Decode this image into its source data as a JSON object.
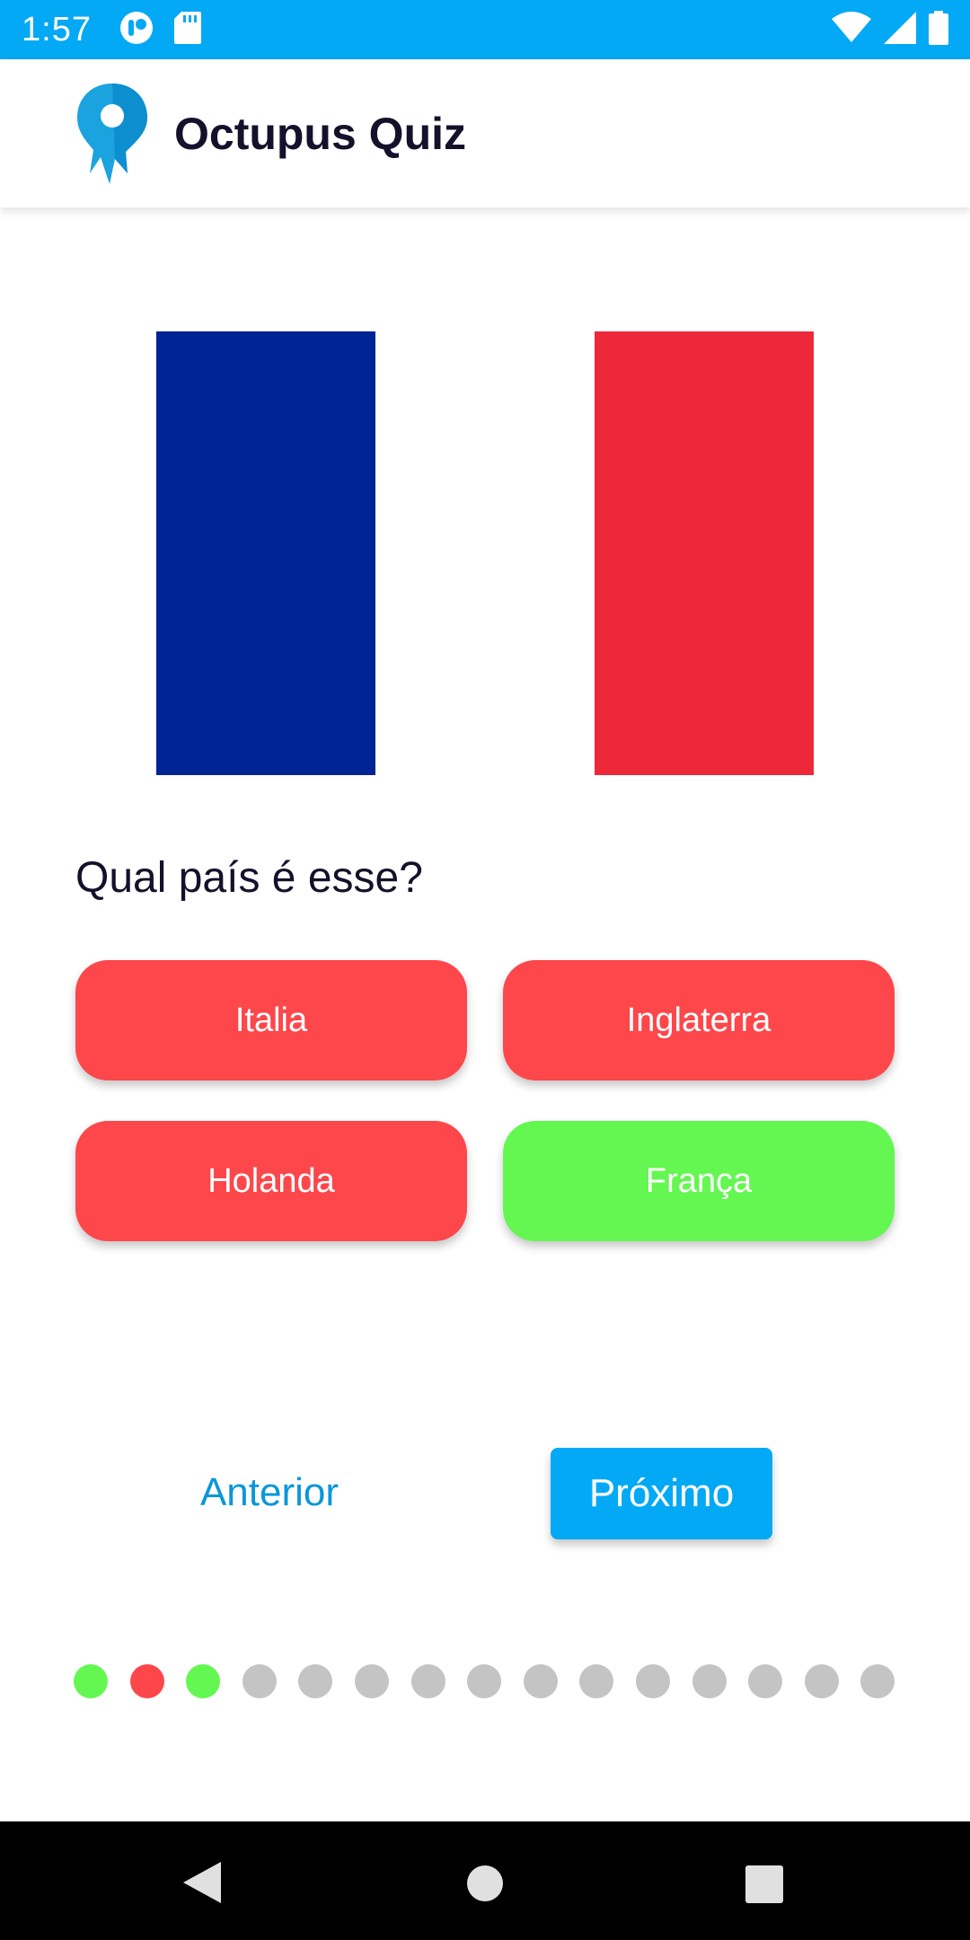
{
  "status_bar": {
    "time": "1:57",
    "icons": [
      "notification-icon",
      "sd-card-icon",
      "wifi-icon",
      "signal-icon",
      "battery-icon"
    ]
  },
  "app_bar": {
    "title": "Octupus Quiz",
    "logo_icon": "octopus-pin-logo"
  },
  "flag": {
    "stripes": [
      "#002395",
      "#ffffff",
      "#ed2939"
    ]
  },
  "question": "Qual país é esse?",
  "options": [
    {
      "label": "Italia",
      "state": "wrong",
      "color": "#fd474b"
    },
    {
      "label": "Inglaterra",
      "state": "wrong",
      "color": "#fd474b"
    },
    {
      "label": "Holanda",
      "state": "wrong",
      "color": "#fd474b"
    },
    {
      "label": "França",
      "state": "correct",
      "color": "#64f751"
    }
  ],
  "navigation": {
    "previous_label": "Anterior",
    "next_label": "Próximo"
  },
  "progress": {
    "total": 15,
    "states": [
      "correct",
      "wrong",
      "correct",
      "pending",
      "pending",
      "pending",
      "pending",
      "pending",
      "pending",
      "pending",
      "pending",
      "pending",
      "pending",
      "pending",
      "pending"
    ],
    "colors": {
      "correct": "#64f751",
      "wrong": "#fd474b",
      "pending": "#c4c4c4"
    }
  },
  "colors": {
    "accent": "#03a9f4",
    "text_dark": "#14112b"
  },
  "system_nav": [
    "back-icon",
    "home-icon",
    "recents-icon"
  ]
}
